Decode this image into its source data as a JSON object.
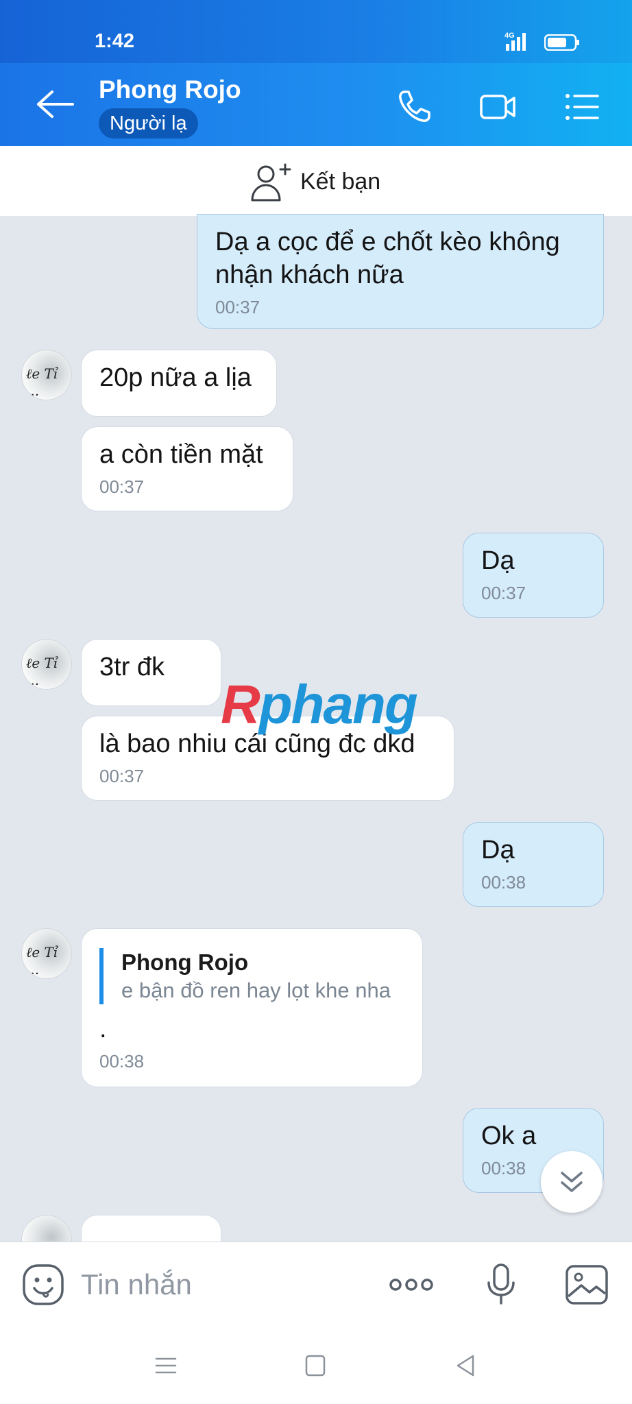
{
  "status": {
    "time": "1:42",
    "network": "4G"
  },
  "header": {
    "title": "Phong Rojo",
    "badge": "Người lạ"
  },
  "add_friend": {
    "label": "Kết bạn"
  },
  "messages": [
    {
      "dir": "out",
      "text": "Dạ a cọc để e chốt kèo không nhận khách nữa",
      "time": "00:37"
    },
    {
      "dir": "in",
      "text": "20p nữa a lịa"
    },
    {
      "dir": "in",
      "text": "a còn tiền mặt",
      "time": "00:37"
    },
    {
      "dir": "out",
      "text": "Dạ",
      "time": "00:37"
    },
    {
      "dir": "in",
      "text": "3tr đk"
    },
    {
      "dir": "in",
      "text": "là bao nhiu cái cũng đc dkd",
      "time": "00:37"
    },
    {
      "dir": "out",
      "text": "Dạ",
      "time": "00:38"
    },
    {
      "dir": "in",
      "quote_name": "Phong Rojo",
      "quote_text": "e bận đồ ren hay lọt khe nha",
      "text": ".",
      "time": "00:38"
    },
    {
      "dir": "out",
      "text": "Ok a",
      "time": "00:38"
    }
  ],
  "watermark": {
    "part1": "R",
    "part2": "phang"
  },
  "composer": {
    "placeholder": "Tin nhắn"
  },
  "colors": {
    "header": "#1e8df0",
    "outgoing_bubble": "#d5ecfb",
    "incoming_bubble": "#ffffff",
    "background": "#e2e7ee"
  },
  "icons": [
    "back-arrow-icon",
    "phone-icon",
    "video-call-icon",
    "menu-icon",
    "add-friend-icon",
    "scroll-down-icon",
    "sticker-icon",
    "more-icon",
    "microphone-icon",
    "image-icon",
    "recents-icon",
    "home-icon",
    "back-nav-icon"
  ]
}
